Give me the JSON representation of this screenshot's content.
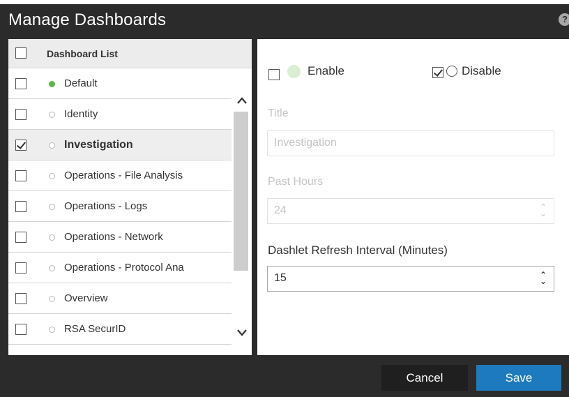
{
  "dialog": {
    "title": "Manage Dashboards",
    "help_icon": "question-circle-icon"
  },
  "list": {
    "header_label": "Dashboard List",
    "items": [
      {
        "label": "Default",
        "checked": false,
        "enabled": true,
        "selected": false
      },
      {
        "label": "Identity",
        "checked": false,
        "enabled": false,
        "selected": false
      },
      {
        "label": "Investigation",
        "checked": true,
        "enabled": false,
        "selected": true
      },
      {
        "label": "Operations - File Analysis",
        "checked": false,
        "enabled": false,
        "selected": false
      },
      {
        "label": "Operations - Logs",
        "checked": false,
        "enabled": false,
        "selected": false
      },
      {
        "label": "Operations - Network",
        "checked": false,
        "enabled": false,
        "selected": false
      },
      {
        "label": "Operations - Protocol Ana",
        "checked": false,
        "enabled": false,
        "selected": false
      },
      {
        "label": "Overview",
        "checked": false,
        "enabled": false,
        "selected": false
      },
      {
        "label": "RSA SecurID",
        "checked": false,
        "enabled": false,
        "selected": false
      }
    ]
  },
  "detail": {
    "enable_label": "Enable",
    "enable_checked": false,
    "disable_label": "Disable",
    "disable_checked": true,
    "title_label": "Title",
    "title_value": "Investigation",
    "past_hours_label": "Past Hours",
    "past_hours_value": "24",
    "refresh_label": "Dashlet Refresh Interval (Minutes)",
    "refresh_value": "15"
  },
  "footer": {
    "cancel_label": "Cancel",
    "save_label": "Save"
  },
  "colors": {
    "enabled_dot": "#5bb946",
    "save_button": "#1d7abf",
    "dialog_bg": "#2b2b2b"
  }
}
